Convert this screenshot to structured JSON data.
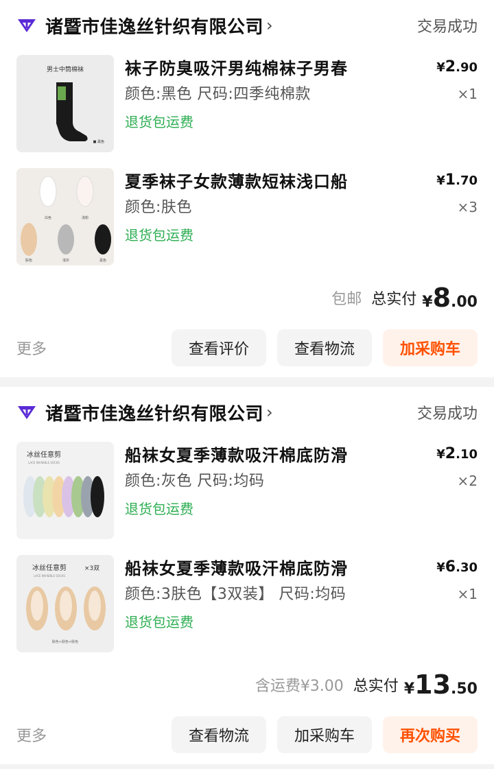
{
  "orders": [
    {
      "shop": "诸暨市佳逸丝针织有限公司",
      "chevron": "›",
      "status": "交易成功",
      "items": [
        {
          "title": "袜子防臭吸汗男纯棉袜子男春",
          "spec": "颜色:黑色 尺码:四季纯棉款",
          "refund": "退货包运费",
          "cur": "¥",
          "price_int": "2",
          "price_dec": ".90",
          "qty": "×1",
          "thumb_text": "男士中筒棉袜",
          "thumb_tag": "■ 黑色"
        },
        {
          "title": "夏季袜子女款薄款短袜浅口船",
          "spec": "颜色:肤色",
          "refund": "退货包运费",
          "cur": "¥",
          "price_int": "1",
          "price_dec": ".70",
          "qty": "×3",
          "thumb_tags": [
            "白色",
            "浅粉",
            "肤色",
            "浅灰",
            "黑色"
          ]
        }
      ],
      "shipping": "包邮",
      "total_label": "总实付",
      "total_cur": "¥",
      "total_int": "8",
      "total_dec": ".00",
      "more": "更多",
      "buttons": [
        "查看评价",
        "查看物流",
        "加采购车"
      ]
    },
    {
      "shop": "诸暨市佳逸丝针织有限公司",
      "chevron": "›",
      "status": "交易成功",
      "items": [
        {
          "title": "船袜女夏季薄款吸汗棉底防滑",
          "spec": "颜色:灰色 尺码:均码",
          "refund": "退货包运费",
          "cur": "¥",
          "price_int": "2",
          "price_dec": ".10",
          "qty": "×2",
          "thumb_text": "冰丝任意剪",
          "thumb_sub": "LACE INVISIBLE SOCKS"
        },
        {
          "title": "船袜女夏季薄款吸汗棉底防滑",
          "spec": "颜色:3肤色【3双装】 尺码:均码",
          "refund": "退货包运费",
          "cur": "¥",
          "price_int": "6",
          "price_dec": ".30",
          "qty": "×1",
          "thumb_text": "冰丝任意剪",
          "thumb_badge": "×3双",
          "thumb_sub": "LACE INVISIBLE SOCKS",
          "thumb_foot": "肤色+肤色+肤色"
        }
      ],
      "shipping": "含运费¥3.00",
      "total_label": "总实付",
      "total_cur": "¥",
      "total_int": "13",
      "total_dec": ".50",
      "more": "更多",
      "buttons": [
        "查看物流",
        "加采购车",
        "再次购买"
      ]
    }
  ],
  "colors": {
    "accent": "#ff5000",
    "refund_green": "#2dae52",
    "logo_purple": "#5b2bd6"
  }
}
